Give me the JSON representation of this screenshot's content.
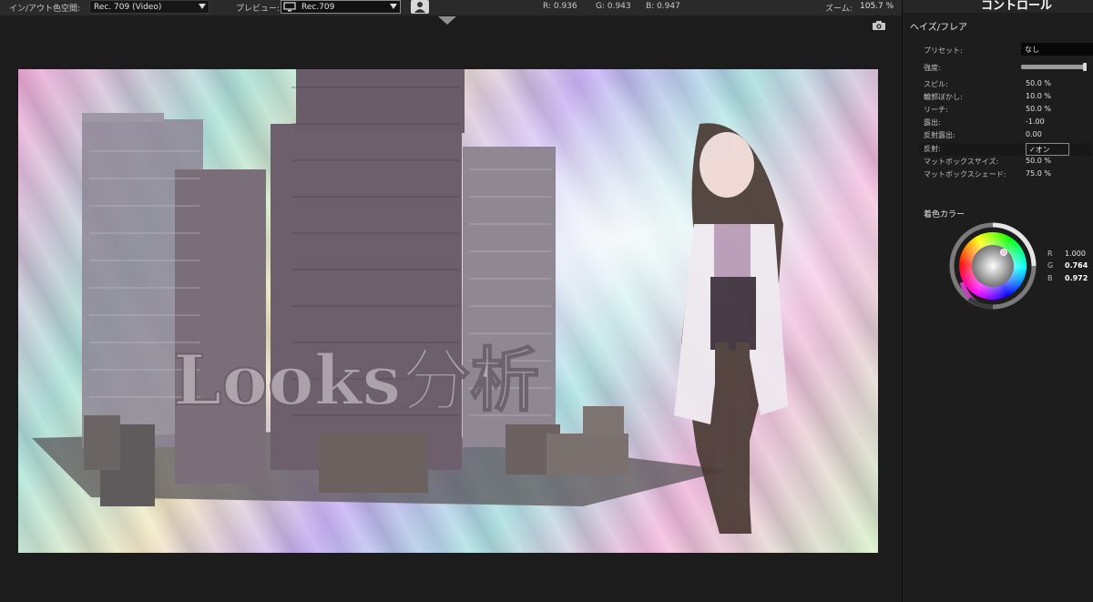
{
  "topbar": {
    "color_space_label": "イン/アウト色空間:",
    "color_space_value": "Rec. 709 (Video)",
    "preview_label": "プレビュー:",
    "preview_value": "Rec.709",
    "r_readout": "R: 0.936",
    "g_readout": "G: 0.943",
    "b_readout": "B: 0.947",
    "zoom_label": "ズーム:",
    "zoom_value": "105.7 %"
  },
  "viewer": {
    "image_title_text": "Looks分析"
  },
  "panel": {
    "title": "コントロール",
    "effect_name": "ヘイズ/フレア",
    "params": {
      "preset_label": "プリセット:",
      "preset_value": "なし",
      "intensity_label": "強度:",
      "intensity_level": 0.97,
      "spill_label": "スピル:",
      "spill_value": "50.0 %",
      "edge_blur_label": "輪郭ぼかし:",
      "edge_blur_value": "10.0 %",
      "reach_label": "リーチ:",
      "reach_value": "50.0 %",
      "exposure_label": "露出:",
      "exposure_value": "-1.00",
      "reflect_exposure_label": "反射露出:",
      "reflect_exposure_value": "0.00",
      "reflect_label": "反射:",
      "reflect_value": "✓オン",
      "matte_size_label": "マットボックスサイズ:",
      "matte_size_value": "50.0 %",
      "matte_shade_label": "マットボックスシェード:",
      "matte_shade_value": "75.0 %"
    },
    "tint": {
      "label": "着色カラー",
      "r_label": "R",
      "r_value": "1.000",
      "g_label": "G",
      "g_value": "0.764",
      "b_label": "B",
      "b_value": "0.972",
      "swatch_color": "#ffc3f8"
    }
  }
}
